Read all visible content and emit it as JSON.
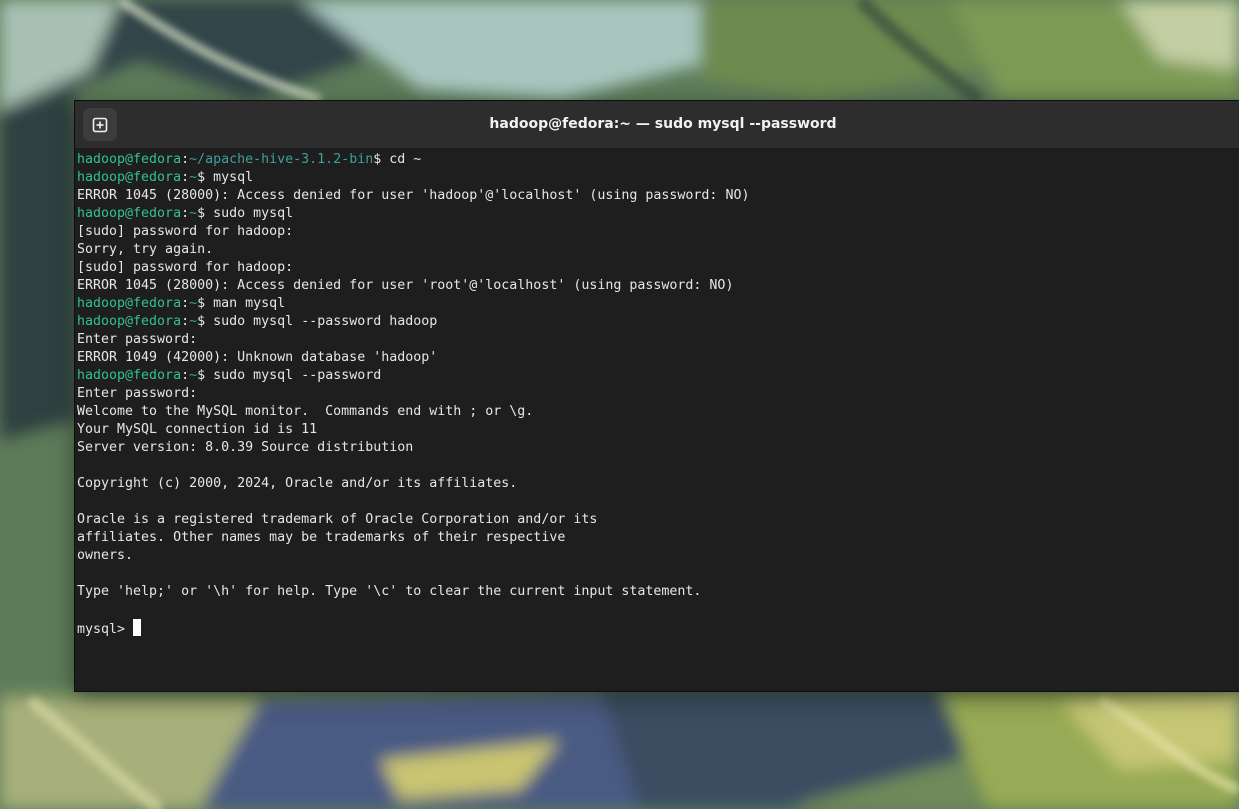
{
  "window": {
    "title": "hadoop@fedora:~ — sudo mysql --password"
  },
  "icons": {
    "new_tab": "new-tab-icon"
  },
  "colors": {
    "terminal_background": "#1e1e1e",
    "titlebar_background": "#2d2d2d",
    "prompt_user": "#33c28a",
    "prompt_path": "#3d9f9f",
    "text": "#e6e6e6"
  },
  "terminal": {
    "lines": [
      {
        "kind": "prompt",
        "user": "hadoop@fedora",
        "path": "~/apache-hive-3.1.2-bin",
        "command": " cd ~"
      },
      {
        "kind": "prompt",
        "user": "hadoop@fedora",
        "path": "~",
        "command": " mysql"
      },
      {
        "kind": "output",
        "text": "ERROR 1045 (28000): Access denied for user 'hadoop'@'localhost' (using password: NO)"
      },
      {
        "kind": "prompt",
        "user": "hadoop@fedora",
        "path": "~",
        "command": " sudo mysql"
      },
      {
        "kind": "output",
        "text": "[sudo] password for hadoop:"
      },
      {
        "kind": "output",
        "text": "Sorry, try again."
      },
      {
        "kind": "output",
        "text": "[sudo] password for hadoop:"
      },
      {
        "kind": "output",
        "text": "ERROR 1045 (28000): Access denied for user 'root'@'localhost' (using password: NO)"
      },
      {
        "kind": "prompt",
        "user": "hadoop@fedora",
        "path": "~",
        "command": " man mysql"
      },
      {
        "kind": "prompt",
        "user": "hadoop@fedora",
        "path": "~",
        "command": " sudo mysql --password hadoop"
      },
      {
        "kind": "output",
        "text": "Enter password:"
      },
      {
        "kind": "output",
        "text": "ERROR 1049 (42000): Unknown database 'hadoop'"
      },
      {
        "kind": "prompt",
        "user": "hadoop@fedora",
        "path": "~",
        "command": " sudo mysql --password"
      },
      {
        "kind": "output",
        "text": "Enter password:"
      },
      {
        "kind": "output",
        "text": "Welcome to the MySQL monitor.  Commands end with ; or \\g."
      },
      {
        "kind": "output",
        "text": "Your MySQL connection id is 11"
      },
      {
        "kind": "output",
        "text": "Server version: 8.0.39 Source distribution"
      },
      {
        "kind": "output",
        "text": ""
      },
      {
        "kind": "output",
        "text": "Copyright (c) 2000, 2024, Oracle and/or its affiliates."
      },
      {
        "kind": "output",
        "text": ""
      },
      {
        "kind": "output",
        "text": "Oracle is a registered trademark of Oracle Corporation and/or its"
      },
      {
        "kind": "output",
        "text": "affiliates. Other names may be trademarks of their respective"
      },
      {
        "kind": "output",
        "text": "owners."
      },
      {
        "kind": "output",
        "text": ""
      },
      {
        "kind": "output",
        "text": "Type 'help;' or '\\h' for help. Type '\\c' to clear the current input statement."
      },
      {
        "kind": "output",
        "text": ""
      },
      {
        "kind": "input",
        "prompt": "mysql> "
      }
    ]
  }
}
